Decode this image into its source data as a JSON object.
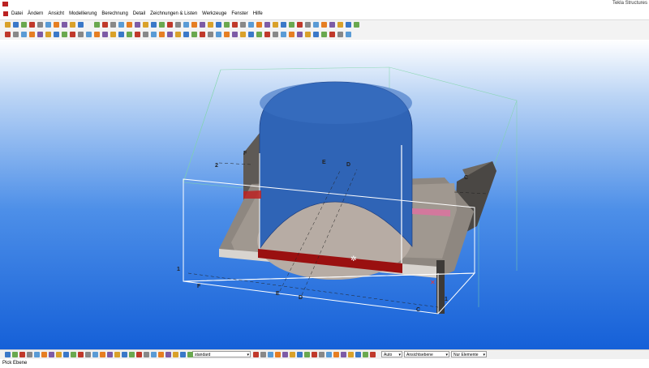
{
  "window": {
    "title": "Tekla Structures"
  },
  "menu": {
    "items": [
      "Datei",
      "Ändern",
      "Ansicht",
      "Modellierung",
      "Berechnung",
      "Detail",
      "Zeichnungen & Listen",
      "Werkzeuge",
      "Fenster",
      "Hilfe"
    ]
  },
  "model": {
    "grid_labels": {
      "f_top": "F",
      "two": "2",
      "e_mid": "E",
      "d_mid": "D",
      "c_right": "C",
      "one_left": "1",
      "f_bottom": "F",
      "e_bottom": "E",
      "d_bottom": "D",
      "c_bottom": "C",
      "one_right": "1"
    }
  },
  "statusbar": {
    "work_plane": "standard",
    "snap_mode": "Auto",
    "view_mode": "Ansichtsebene",
    "depth_mode": "Nur Elemente"
  },
  "hint": {
    "text": "Pick Ebene"
  },
  "colors": {
    "tank": "#3467b8",
    "slab": "#8e8780",
    "weld": "#9a1010",
    "bg_bottom": "#1560d8"
  }
}
